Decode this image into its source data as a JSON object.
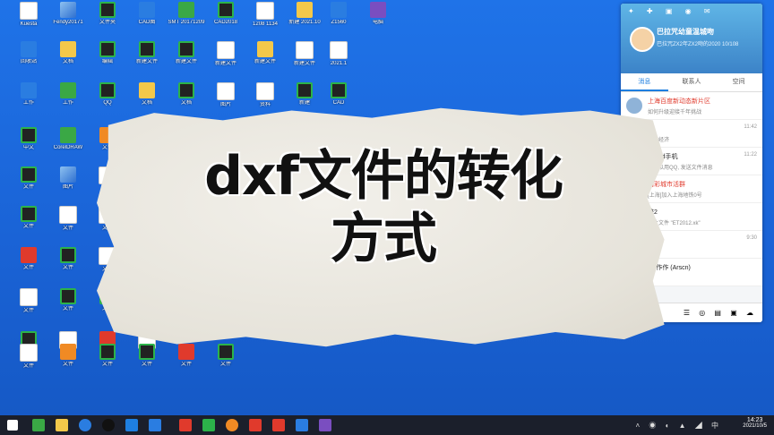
{
  "desktop": {
    "icons": [
      {
        "label": "Kuesta",
        "glyph": "g-doc"
      },
      {
        "label": "Fendy20171",
        "glyph": "g-pic"
      },
      {
        "label": "文件夹",
        "glyph": "g-cad"
      },
      {
        "label": "CAD图",
        "glyph": "g-blue"
      },
      {
        "label": "SMT 20171209",
        "glyph": "g-green"
      },
      {
        "label": "CAD2018",
        "glyph": "g-cad"
      },
      {
        "label": "1208 1134",
        "glyph": "g-doc"
      },
      {
        "label": "新建 2021.10",
        "glyph": "g-folder"
      },
      {
        "label": "Z1560",
        "glyph": "g-blue"
      },
      {
        "label": "电脑",
        "glyph": "g-purple"
      },
      {
        "label": "回收站",
        "glyph": "g-blue"
      },
      {
        "label": "文档",
        "glyph": "g-folder"
      },
      {
        "label": "编辑",
        "glyph": "g-cad"
      },
      {
        "label": "新建文件",
        "glyph": "g-cad"
      },
      {
        "label": "新建文件",
        "glyph": "g-cad"
      },
      {
        "label": "新建文件",
        "glyph": "g-doc"
      },
      {
        "label": "新建文件",
        "glyph": "g-folder"
      },
      {
        "label": "新建文件",
        "glyph": "g-doc"
      },
      {
        "label": "2021.1",
        "glyph": "g-doc"
      },
      {
        "label": "工作",
        "glyph": "g-blue"
      },
      {
        "label": "工作",
        "glyph": "g-green"
      },
      {
        "label": "QQ",
        "glyph": "g-cad"
      },
      {
        "label": "文档",
        "glyph": "g-folder"
      },
      {
        "label": "文档",
        "glyph": "g-cad"
      },
      {
        "label": "图片",
        "glyph": "g-doc"
      },
      {
        "label": "资料",
        "glyph": "g-doc"
      },
      {
        "label": "新建",
        "glyph": "g-cad"
      },
      {
        "label": "CAD",
        "glyph": "g-cad"
      },
      {
        "label": "中文",
        "glyph": "g-cad"
      },
      {
        "label": "CorelDRAW",
        "glyph": "g-green"
      },
      {
        "label": "文件",
        "glyph": "g-orange"
      },
      {
        "label": "文件",
        "glyph": "g-cad"
      },
      {
        "label": "图片",
        "glyph": "g-pic"
      },
      {
        "label": "文件",
        "glyph": "g-doc"
      },
      {
        "label": "文件",
        "glyph": "g-cad"
      },
      {
        "label": "文件",
        "glyph": "g-doc"
      },
      {
        "label": "文件",
        "glyph": "g-doc"
      },
      {
        "label": "文件",
        "glyph": "g-red"
      },
      {
        "label": "文件",
        "glyph": "g-cad"
      },
      {
        "label": "文件",
        "glyph": "g-doc"
      },
      {
        "label": "文件",
        "glyph": "g-doc"
      },
      {
        "label": "文件",
        "glyph": "g-cad"
      },
      {
        "label": "文件",
        "glyph": "g-cad"
      },
      {
        "label": "文件",
        "glyph": "g-cad"
      },
      {
        "label": "文件",
        "glyph": "g-doc"
      },
      {
        "label": "文件",
        "glyph": "g-red"
      },
      {
        "label": "文件",
        "glyph": "g-doc"
      },
      {
        "label": "文件",
        "glyph": "g-doc"
      },
      {
        "label": "文件",
        "glyph": "g-orange"
      },
      {
        "label": "文件",
        "glyph": "g-cad"
      },
      {
        "label": "文件",
        "glyph": "g-cad"
      },
      {
        "label": "文件",
        "glyph": "g-red"
      },
      {
        "label": "文件",
        "glyph": "g-cad"
      }
    ]
  },
  "headline": {
    "line1": "dxf文件的转化",
    "line2": "方式"
  },
  "qq": {
    "name": "巴拉咒幼童温城吻",
    "signature": "巴拉咒ZX2年ZX2吻的2020 10/108",
    "tabs": [
      "消息",
      "联系人",
      "空间"
    ],
    "messages": [
      {
        "title": "上海百度新动态新片区",
        "sub": "如何升级迎接千年挑战",
        "time": "",
        "red": true
      },
      {
        "title": "",
        "sub": "发展经济",
        "time": "11:42",
        "red": false
      },
      {
        "title": "ndroid手机",
        "sub": "你可以用QQ, 发送文件消息",
        "time": "11:22",
        "red": false
      },
      {
        "title": "精彩城市活群",
        "sub": "[上海]加入上海地铁0号",
        "time": "",
        "red": true
      },
      {
        "title": "辞2",
        "sub": "图片文件 \"ET2012.xk\"",
        "time": "",
        "red": false
      },
      {
        "title": "",
        "sub": "",
        "time": "9:30",
        "red": false
      },
      {
        "title": "-写作作 (Arscn)",
        "sub": "",
        "time": "",
        "red": false
      }
    ]
  },
  "taskbar": {
    "time": "14:23",
    "date": "2021/10/5"
  }
}
